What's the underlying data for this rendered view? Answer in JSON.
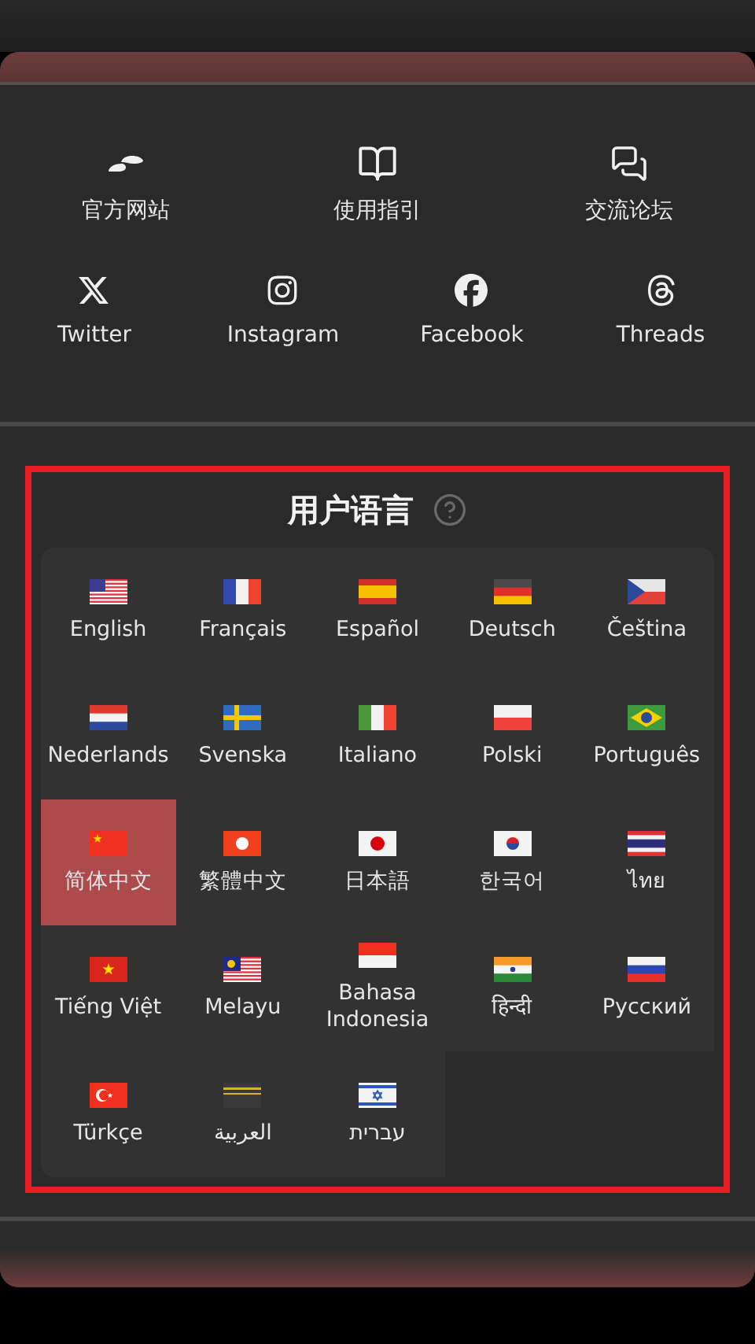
{
  "links": [
    {
      "label": "官方网站"
    },
    {
      "label": "使用指引"
    },
    {
      "label": "交流论坛"
    }
  ],
  "socials": [
    {
      "label": "Twitter"
    },
    {
      "label": "Instagram"
    },
    {
      "label": "Facebook"
    },
    {
      "label": "Threads"
    }
  ],
  "language_section": {
    "title": "用户语言",
    "languages": [
      {
        "label": "English",
        "selected": false
      },
      {
        "label": "Français",
        "selected": false
      },
      {
        "label": "Español",
        "selected": false
      },
      {
        "label": "Deutsch",
        "selected": false
      },
      {
        "label": "Čeština",
        "selected": false
      },
      {
        "label": "Nederlands",
        "selected": false
      },
      {
        "label": "Svenska",
        "selected": false
      },
      {
        "label": "Italiano",
        "selected": false
      },
      {
        "label": "Polski",
        "selected": false
      },
      {
        "label": "Português",
        "selected": false
      },
      {
        "label": "简体中文",
        "selected": true
      },
      {
        "label": "繁體中文",
        "selected": false
      },
      {
        "label": "日本語",
        "selected": false
      },
      {
        "label": "한국어",
        "selected": false
      },
      {
        "label": "ไทย",
        "selected": false
      },
      {
        "label": "Tiếng Việt",
        "selected": false
      },
      {
        "label": "Melayu",
        "selected": false
      },
      {
        "label": "Bahasa Indonesia",
        "selected": false
      },
      {
        "label": "हिन्दी",
        "selected": false
      },
      {
        "label": "Русский",
        "selected": false
      },
      {
        "label": "Türkçe",
        "selected": false
      },
      {
        "label": "العربية",
        "selected": false
      },
      {
        "label": "עברית",
        "selected": false
      }
    ]
  }
}
